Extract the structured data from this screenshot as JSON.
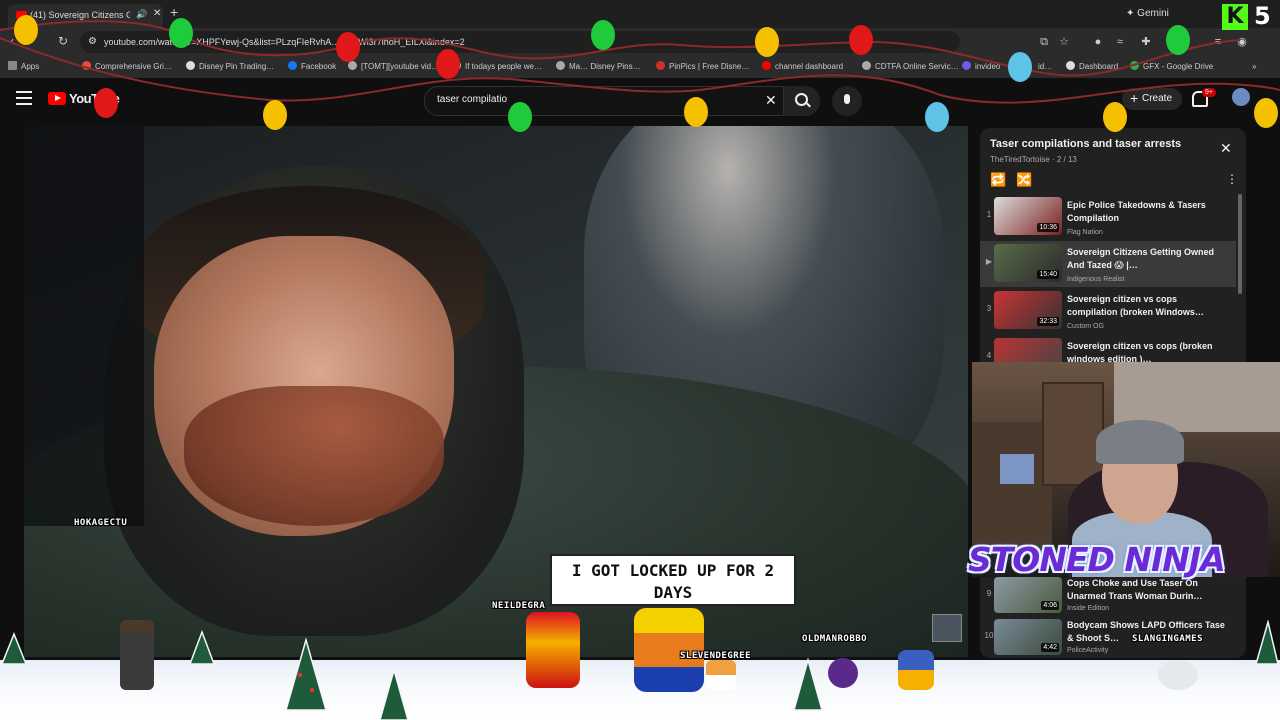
{
  "browser": {
    "tab_title": "(41) Sovereign Citizens Gett",
    "new_tab": "+",
    "url": "youtube.com/watch?v=XHPFYewj-Qs&list=PLzqFIeRvhA…EoOWi3r7ihoH_EILXl&index=2",
    "gemini_label": "Gemini",
    "bookmarks": [
      "Apps",
      "Comprehensive Gri…",
      "Disney Pin Trading…",
      "Facebook",
      "[TOMT][youtube vid…",
      "If todays people we…",
      "Ma… Disney Pins…",
      "PinPics | Free Disne…",
      "channel dashboard",
      "CDTFA Online Servic…",
      "invideo",
      "id…",
      "Dashboard",
      "GFX - Google Drive"
    ]
  },
  "youtube": {
    "logo_text": "YouTube",
    "search_value": "taser compilatio",
    "create_label": "Create",
    "notifications": "9+"
  },
  "playlist": {
    "title": "Taser compilations and taser arrests",
    "subtitle": "TheTiredTortoise · 2 / 13",
    "items": [
      {
        "index": "1",
        "title": "Epic Police Takedowns & Tasers Compilation",
        "channel": "Flag Nation",
        "duration": "10:36"
      },
      {
        "index": "▶",
        "title": "Sovereign Citizens Getting Owned And Tazed 😱 |…",
        "channel": "Indigenous Realist",
        "duration": "15:40"
      },
      {
        "index": "3",
        "title": "Sovereign citizen vs cops compilation (broken Windows…",
        "channel": "Custom OG",
        "duration": "32:33"
      },
      {
        "index": "4",
        "title": "Sovereign citizen vs cops (broken windows edition )…",
        "channel": "",
        "duration": ""
      }
    ],
    "lower_items": [
      {
        "index": "9",
        "title": "Cops Choke and Use Taser On Unarmed Trans Woman Durin…",
        "channel": "Inside Edition",
        "duration": "4:06"
      },
      {
        "index": "10",
        "title": "Bodycam Shows LAPD Officers Tase & Shoot S…",
        "channel": "PoliceActivity",
        "duration": "4:42"
      }
    ]
  },
  "overlay": {
    "brand": "STONED NINJA",
    "speech": "I GOT LOCKED UP FOR 2 DAYS",
    "kick_letter": "K",
    "kick_count": "5",
    "names": [
      "HOKAGECTU",
      "NEILDEGRA",
      "SLEVENDEGREE",
      "OLDMANROBBO",
      "SLANGINGAMES"
    ]
  }
}
